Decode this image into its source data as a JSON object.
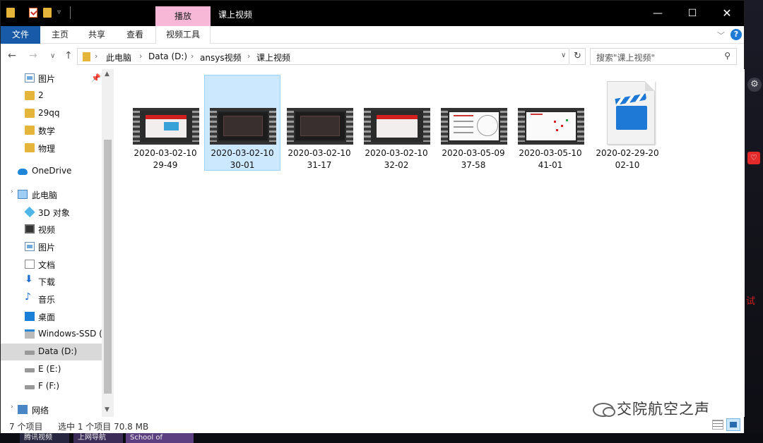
{
  "window": {
    "title": "课上视频",
    "context_tab": "播放",
    "controls": {
      "minimize": "—",
      "maximize": "☐",
      "close": "✕"
    }
  },
  "ribbon": {
    "tabs": [
      "文件",
      "主页",
      "共享",
      "查看",
      "视频工具"
    ],
    "help": "?"
  },
  "address": {
    "crumbs": [
      "此电脑",
      "Data (D:)",
      "ansys视频",
      "课上视频"
    ],
    "search_placeholder": "搜索\"课上视频\""
  },
  "sidebar": {
    "items": [
      {
        "label": "图片",
        "icon": "pictures-icon",
        "pinned": true
      },
      {
        "label": "2",
        "icon": "folder-icon"
      },
      {
        "label": "29qq",
        "icon": "folder-icon"
      },
      {
        "label": "数学",
        "icon": "folder-icon"
      },
      {
        "label": "物理",
        "icon": "folder-icon"
      },
      {
        "label": "OneDrive",
        "icon": "cloud-icon"
      },
      {
        "label": "此电脑",
        "icon": "computer-icon"
      },
      {
        "label": "3D 对象",
        "icon": "3d-objects-icon"
      },
      {
        "label": "视频",
        "icon": "video-icon"
      },
      {
        "label": "图片",
        "icon": "pictures-icon"
      },
      {
        "label": "文档",
        "icon": "document-icon"
      },
      {
        "label": "下载",
        "icon": "download-icon"
      },
      {
        "label": "音乐",
        "icon": "music-icon"
      },
      {
        "label": "桌面",
        "icon": "desktop-icon"
      },
      {
        "label": "Windows-SSD (",
        "icon": "windows-drive-icon"
      },
      {
        "label": "Data (D:)",
        "icon": "drive-icon",
        "selected": true
      },
      {
        "label": "E (E:)",
        "icon": "drive-icon"
      },
      {
        "label": "F (F:)",
        "icon": "drive-icon"
      },
      {
        "label": "网络",
        "icon": "network-icon"
      }
    ]
  },
  "files": [
    {
      "name": "2020-03-02-10\n29-49",
      "line1": "2020-03-02-10",
      "line2": "29-49",
      "thumb": "red-slide"
    },
    {
      "name": "2020-03-02-10\n30-01",
      "line1": "2020-03-02-10",
      "line2": "30-01",
      "thumb": "dark-slide",
      "selected": true
    },
    {
      "name": "2020-03-02-10\n31-17",
      "line1": "2020-03-02-10",
      "line2": "31-17",
      "thumb": "dark-slide"
    },
    {
      "name": "2020-03-02-10\n32-02",
      "line1": "2020-03-02-10",
      "line2": "32-02",
      "thumb": "red-slide"
    },
    {
      "name": "2020-03-05-09\n37-58",
      "line1": "2020-03-05-09",
      "line2": "37-58",
      "thumb": "white-slide"
    },
    {
      "name": "2020-03-05-10\n41-01",
      "line1": "2020-03-05-10",
      "line2": "41-01",
      "thumb": "white-dots"
    },
    {
      "name": "2020-02-29-20\n02-10",
      "line1": "2020-02-29-20",
      "line2": "02-10",
      "thumb": "clapper-icon"
    }
  ],
  "status": {
    "count": "7 个项目",
    "selected": "选中 1 个项目  70.8 MB"
  },
  "watermark": "交院航空之声",
  "taskbar": [
    "腾讯视频",
    "上网导航",
    "School of"
  ],
  "colors": {
    "accent": "#195aa8",
    "selection": "#cce8ff",
    "context_tab": "#f7b8d8"
  }
}
